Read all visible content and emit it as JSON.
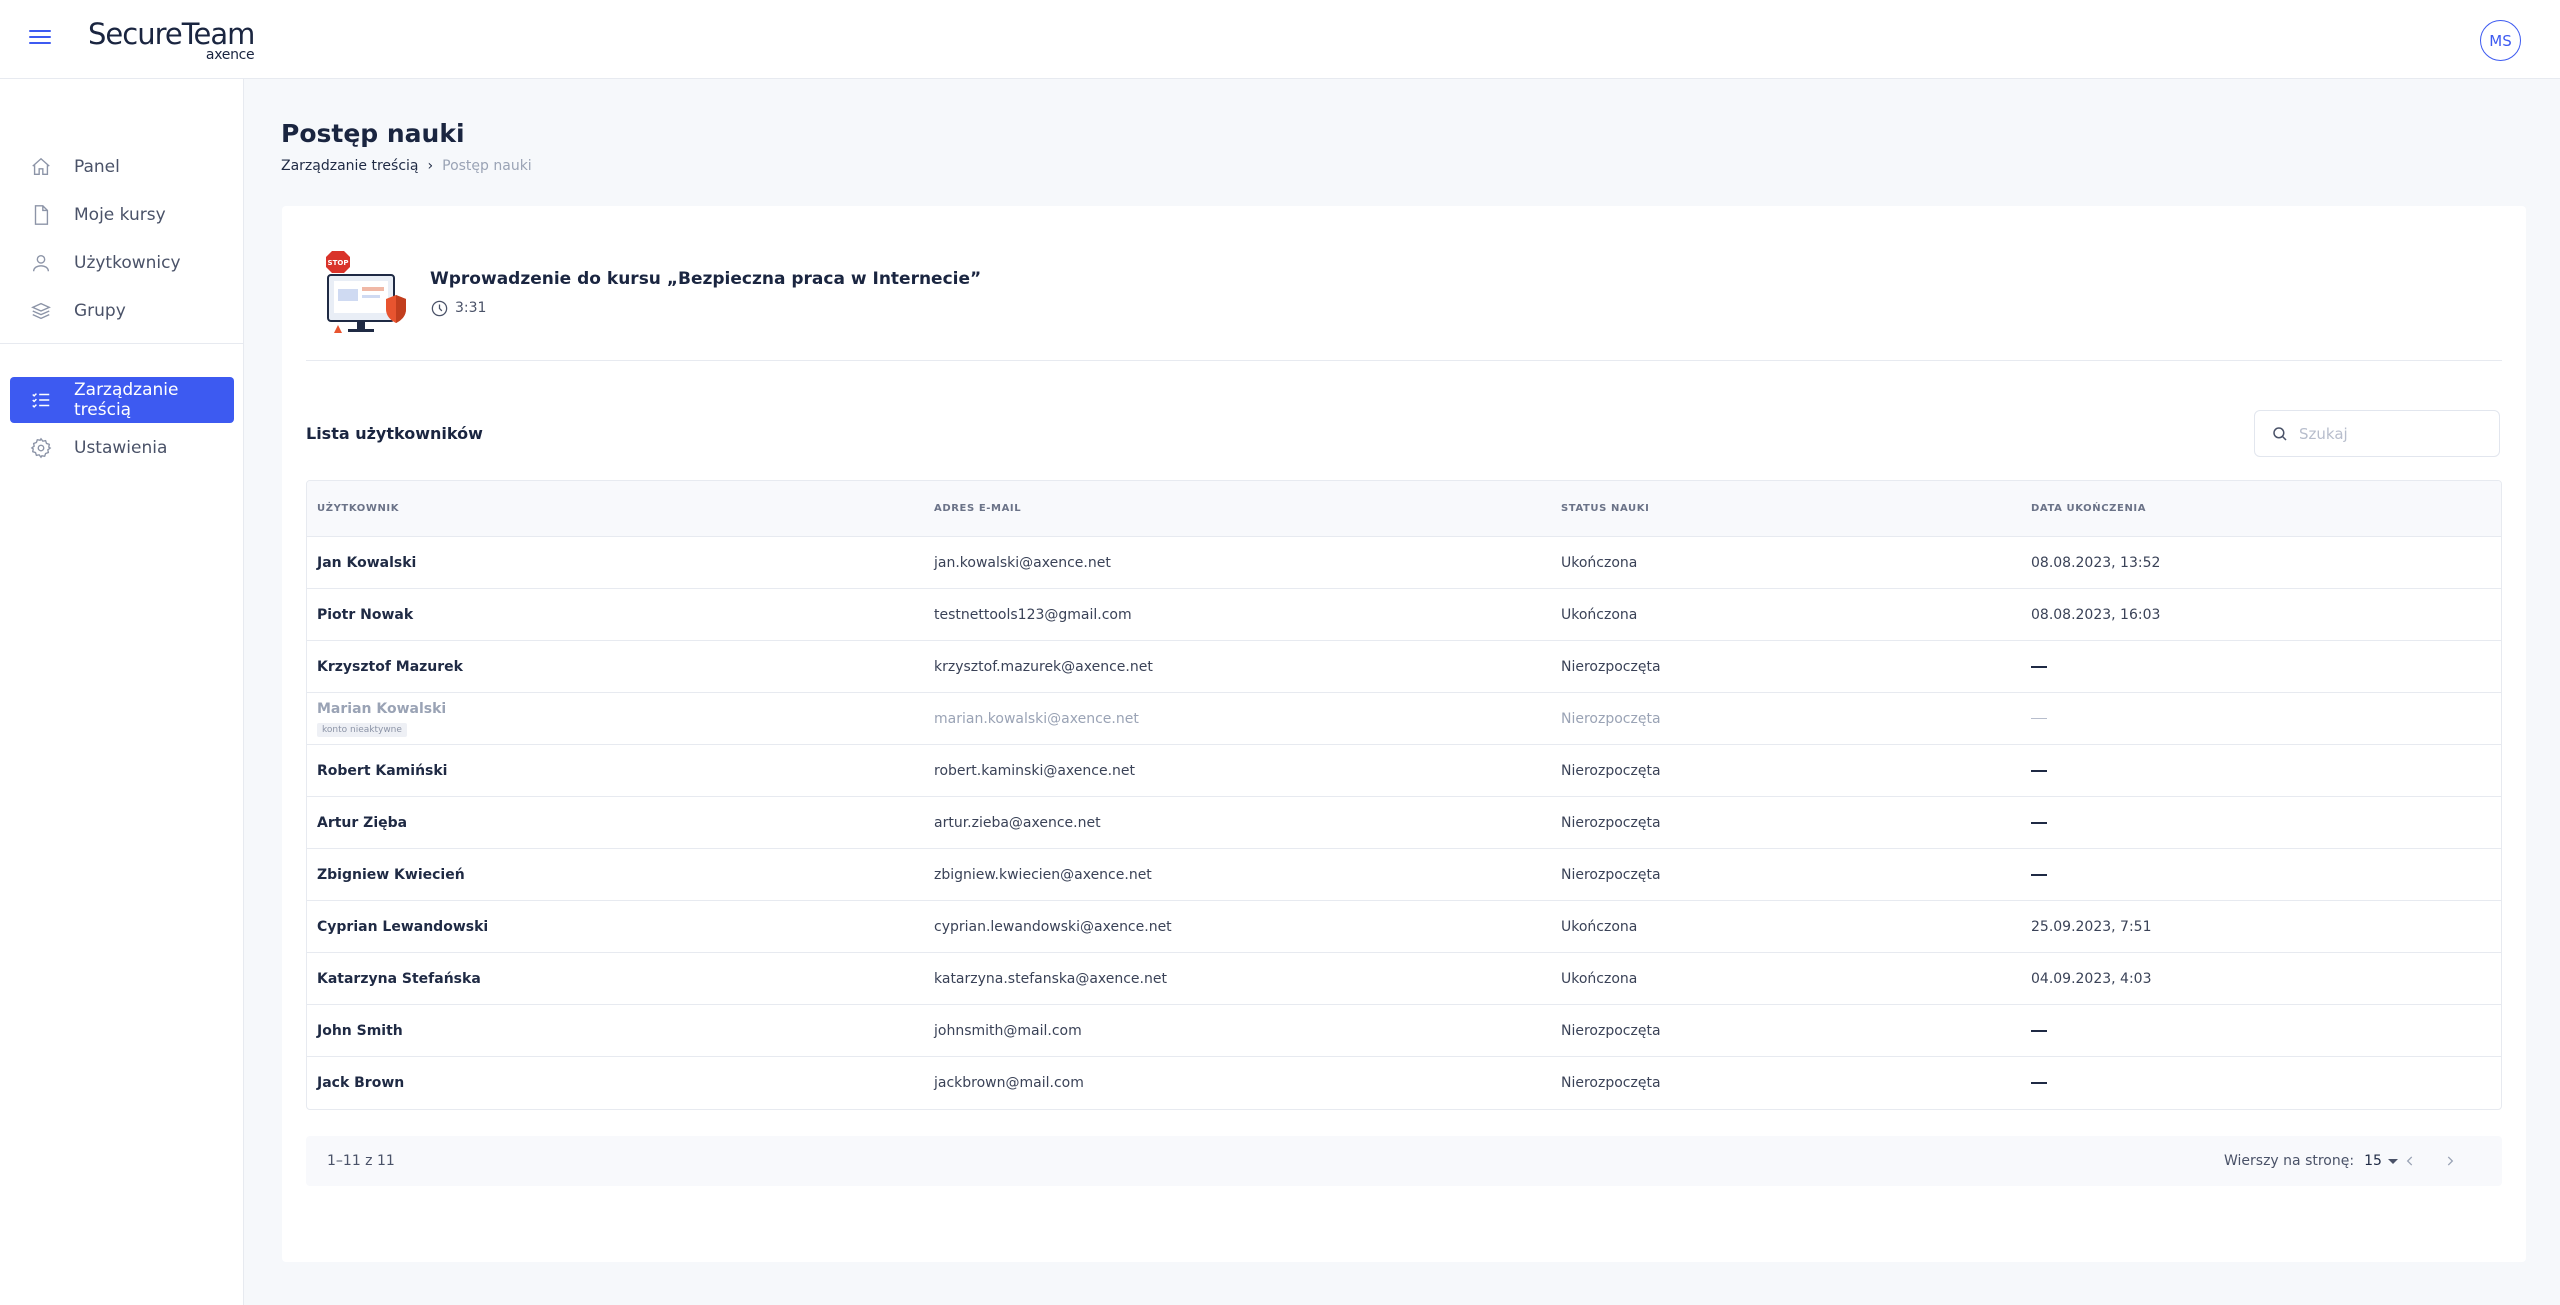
{
  "header": {
    "logo_main": "SecureTeam",
    "logo_sub": "axence",
    "avatar_initials": "MS",
    "accent": "#3d5af1"
  },
  "sidebar": {
    "items": [
      {
        "label": "Panel",
        "icon": "home-icon"
      },
      {
        "label": "Moje kursy",
        "icon": "document-icon"
      },
      {
        "label": "Użytkownicy",
        "icon": "user-icon"
      },
      {
        "label": "Grupy",
        "icon": "layers-icon"
      },
      {
        "label": "Zarządzanie treścią",
        "icon": "list-check-icon",
        "active": true
      },
      {
        "label": "Ustawienia",
        "icon": "gear-icon"
      }
    ]
  },
  "page": {
    "title": "Postęp nauki",
    "breadcrumb": [
      "Zarządzanie treścią",
      "Postęp nauki"
    ]
  },
  "course": {
    "title": "Wprowadzenie do kursu „Bezpieczna praca w Internecie”",
    "duration": "3:31",
    "thumb_badge": "STOP"
  },
  "users": {
    "title": "Lista użytkowników",
    "search_placeholder": "Szukaj",
    "columns": [
      "Użytkownik",
      "Adres e-mail",
      "Status nauki",
      "Data ukończenia"
    ],
    "rows": [
      {
        "name": "Jan Kowalski",
        "email": "jan.kowalski@axence.net",
        "status": "Ukończona",
        "date": "08.08.2023, 13:52"
      },
      {
        "name": "Piotr Nowak",
        "email": "testnettools123@gmail.com",
        "status": "Ukończona",
        "date": "08.08.2023, 16:03"
      },
      {
        "name": "Krzysztof Mazurek",
        "email": "krzysztof.mazurek@axence.net",
        "status": "Nierozpoczęta",
        "date": ""
      },
      {
        "name": "Marian Kowalski",
        "email": "marian.kowalski@axence.net",
        "status": "Nierozpoczęta",
        "date": "",
        "inactive": true,
        "badge": "konto nieaktywne"
      },
      {
        "name": "Robert Kamiński",
        "email": "robert.kaminski@axence.net",
        "status": "Nierozpoczęta",
        "date": ""
      },
      {
        "name": "Artur Zięba",
        "email": "artur.zieba@axence.net",
        "status": "Nierozpoczęta",
        "date": ""
      },
      {
        "name": "Zbigniew Kwiecień",
        "email": "zbigniew.kwiecien@axence.net",
        "status": "Nierozpoczęta",
        "date": ""
      },
      {
        "name": "Cyprian Lewandowski",
        "email": "cyprian.lewandowski@axence.net",
        "status": "Ukończona",
        "date": "25.09.2023, 7:51"
      },
      {
        "name": "Katarzyna Stefańska",
        "email": "katarzyna.stefanska@axence.net",
        "status": "Ukończona",
        "date": "04.09.2023, 4:03"
      },
      {
        "name": "John Smith",
        "email": "johnsmith@mail.com",
        "status": "Nierozpoczęta",
        "date": ""
      },
      {
        "name": "Jack Brown",
        "email": "jackbrown@mail.com",
        "status": "Nierozpoczęta",
        "date": ""
      }
    ]
  },
  "pagination": {
    "range": "1–11 z 11",
    "rows_label": "Wierszy na stronę:",
    "rows_value": "15"
  }
}
